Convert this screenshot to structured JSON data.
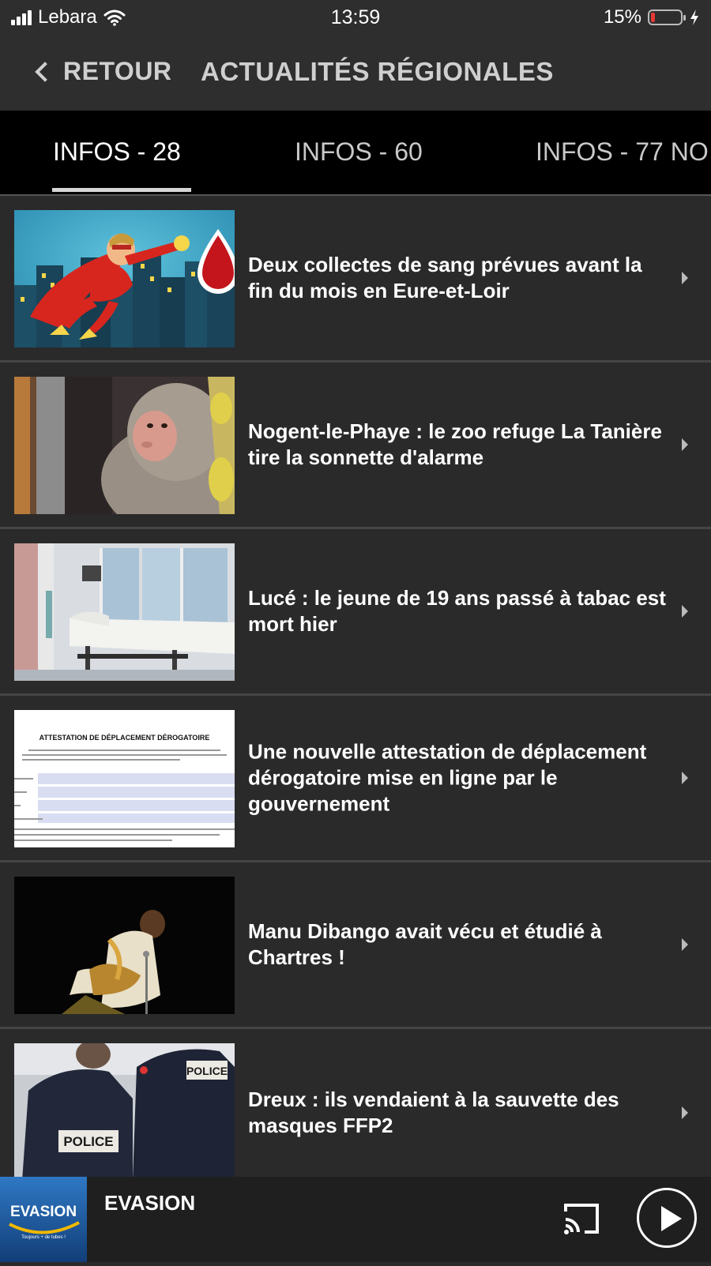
{
  "status": {
    "carrier": "Lebara",
    "time": "13:59",
    "battery_percent": "15%",
    "battery_level": 0.15
  },
  "header": {
    "back_label": "RETOUR",
    "title": "ACTUALITÉS RÉGIONALES"
  },
  "tabs": [
    {
      "label": "INFOS - 28",
      "active": true
    },
    {
      "label": "INFOS - 60",
      "active": false
    },
    {
      "label": "INFOS - 77 NO",
      "active": false
    }
  ],
  "articles": [
    {
      "title": "Deux collectes de sang prévues avant la fin du mois en Eure-et-Loir",
      "image": "superhero-blood-drop-illustration"
    },
    {
      "title": "Nogent-le-Phaye : le zoo refuge La Tanière tire la sonnette d'alarme",
      "image": "macaque-photo"
    },
    {
      "title": "Lucé : le jeune de 19 ans passé à tabac est mort hier",
      "image": "hospital-room-photo"
    },
    {
      "title": "Une nouvelle attestation de déplacement dérogatoire mise en ligne par le gouvernement",
      "image": "attestation-document"
    },
    {
      "title": "Manu Dibango avait vécu et étudié à Chartres !",
      "image": "saxophonist-photo"
    },
    {
      "title": "Dreux : ils vendaient à la sauvette des masques FFP2",
      "image": "police-officers-photo"
    }
  ],
  "attestation_heading": "ATTESTATION DE DÉPLACEMENT DÉROGATOIRE",
  "police_label": "POLICE",
  "player": {
    "station": "EVASION",
    "logo_text": "EVASION",
    "logo_tagline": "Toujours + de tubes !"
  }
}
